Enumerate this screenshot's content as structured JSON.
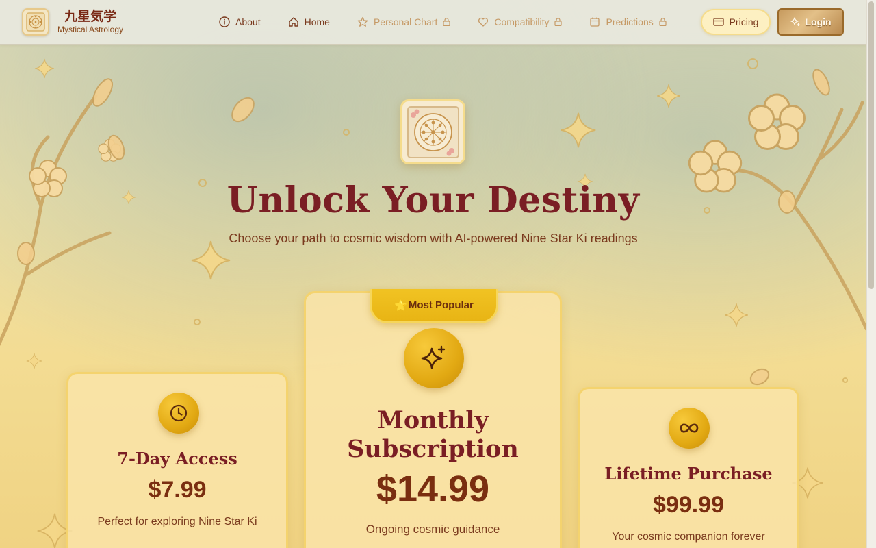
{
  "brand": {
    "title": "九星気学",
    "subtitle": "Mystical Astrology",
    "logo_icon": "nine-star-mandala-icon"
  },
  "nav": {
    "items": [
      {
        "label": "About",
        "icon": "info-icon",
        "locked": false
      },
      {
        "label": "Home",
        "icon": "home-icon",
        "locked": false
      },
      {
        "label": "Personal Chart",
        "icon": "star-icon",
        "locked": true
      },
      {
        "label": "Compatibility",
        "icon": "heart-icon",
        "locked": true
      },
      {
        "label": "Predictions",
        "icon": "calendar-icon",
        "locked": true
      }
    ],
    "pricing_label": "Pricing",
    "login_label": "Login"
  },
  "hero": {
    "title": "Unlock Your Destiny",
    "subtitle": "Choose your path to cosmic wisdom with AI-powered Nine Star Ki readings"
  },
  "plans": {
    "weekly": {
      "title": "7-Day Access",
      "price": "$7.99",
      "description": "Perfect for exploring Nine Star Ki",
      "icon": "clock-icon"
    },
    "monthly": {
      "badge": "Most Popular",
      "badge_icon": "⭐",
      "title": "Monthly Subscription",
      "price": "$14.99",
      "description": "Ongoing cosmic guidance",
      "icon": "sparkles-icon"
    },
    "lifetime": {
      "title": "Lifetime Purchase",
      "price": "$99.99",
      "description": "Your cosmic companion forever",
      "icon": "infinity-icon"
    }
  },
  "colors": {
    "accent": "#e2a913",
    "title": "#7a1e24",
    "text": "#7a3a1e",
    "locked": "#c69a66"
  }
}
